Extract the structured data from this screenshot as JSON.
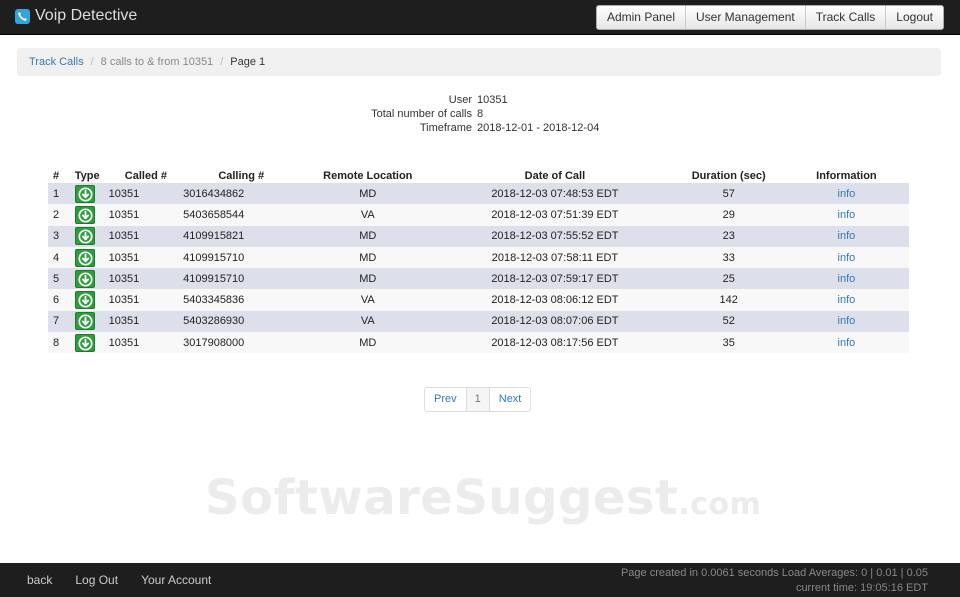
{
  "app": {
    "title": "Voip Detective"
  },
  "topnav": {
    "admin_panel": "Admin Panel",
    "user_management": "User Management",
    "track_calls": "Track Calls",
    "logout": "Logout"
  },
  "breadcrumb": {
    "root": "Track Calls",
    "middle": "8 calls to & from 10351",
    "current": "Page 1"
  },
  "summary": {
    "user_label": "User",
    "user_value": "10351",
    "total_label": "Total number of calls",
    "total_value": "8",
    "timeframe_label": "Timeframe",
    "timeframe_value": "2018-12-01 - 2018-12-04"
  },
  "table": {
    "headers": [
      "#",
      "Type",
      "Called #",
      "Calling #",
      "Remote Location",
      "Date of Call",
      "Duration (sec)",
      "Information"
    ],
    "rows": [
      {
        "num": "1",
        "type": "download-arrow-icon",
        "called": "10351",
        "calling": "3016434862",
        "remote": "MD",
        "date": "2018-12-03 07:48:53 EDT",
        "duration": "57",
        "info": "info"
      },
      {
        "num": "2",
        "type": "download-arrow-icon",
        "called": "10351",
        "calling": "5403658544",
        "remote": "VA",
        "date": "2018-12-03 07:51:39 EDT",
        "duration": "29",
        "info": "info"
      },
      {
        "num": "3",
        "type": "download-arrow-icon",
        "called": "10351",
        "calling": "4109915821",
        "remote": "MD",
        "date": "2018-12-03 07:55:52 EDT",
        "duration": "23",
        "info": "info"
      },
      {
        "num": "4",
        "type": "download-arrow-icon",
        "called": "10351",
        "calling": "4109915710",
        "remote": "MD",
        "date": "2018-12-03 07:58:11 EDT",
        "duration": "33",
        "info": "info"
      },
      {
        "num": "5",
        "type": "download-arrow-icon",
        "called": "10351",
        "calling": "4109915710",
        "remote": "MD",
        "date": "2018-12-03 07:59:17 EDT",
        "duration": "25",
        "info": "info"
      },
      {
        "num": "6",
        "type": "download-arrow-icon",
        "called": "10351",
        "calling": "5403345836",
        "remote": "VA",
        "date": "2018-12-03 08:06:12 EDT",
        "duration": "142",
        "info": "info"
      },
      {
        "num": "7",
        "type": "download-arrow-icon",
        "called": "10351",
        "calling": "5403286930",
        "remote": "VA",
        "date": "2018-12-03 08:07:06 EDT",
        "duration": "52",
        "info": "info"
      },
      {
        "num": "8",
        "type": "download-arrow-icon",
        "called": "10351",
        "calling": "3017908000",
        "remote": "MD",
        "date": "2018-12-03 08:17:56 EDT",
        "duration": "35",
        "info": "info"
      }
    ]
  },
  "pager": {
    "prev": "Prev",
    "page": "1",
    "next": "Next"
  },
  "watermark": {
    "main": "SoftwareSuggest",
    "suffix": ".com"
  },
  "footer": {
    "back": "back",
    "logout": "Log Out",
    "account": "Your Account",
    "stats_line1": "Page created in 0.0061 seconds Load Averages: 0 | 0.01 | 0.05",
    "stats_line2": "current time: 19:05:16 EDT"
  },
  "colors": {
    "topbar": "#1e1e1e",
    "accent": "#337ab7",
    "type_icon": "#2e9e3c",
    "row_odd": "#dde0ea"
  }
}
